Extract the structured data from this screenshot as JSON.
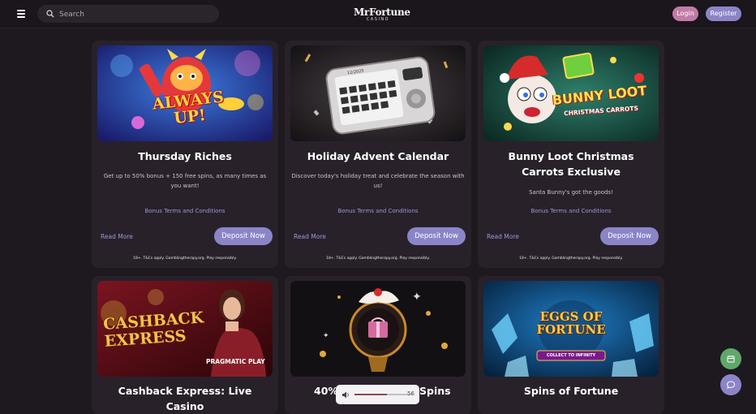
{
  "header": {
    "search_placeholder": "Search",
    "logo_main": "MrFortune",
    "logo_sub": "CASINO",
    "login_label": "Login",
    "register_label": "Register",
    "icons": [
      "menu-icon",
      "search-icon"
    ]
  },
  "promos": [
    {
      "title": "Thursday Riches",
      "desc": "Get up to 50% bonus + 150 free spins, as many times as you want!",
      "terms": "Bonus Terms and Conditions",
      "read_more": "Read More",
      "deposit": "Deposit Now",
      "disclaimer": "18+. T&Cs apply. Gamblingtherapy.org. Play responsibly.",
      "art_text": "ALWAYS UP!"
    },
    {
      "title": "Holiday Advent Calendar",
      "desc": "Discover today's holiday treat and celebrate the season with us!",
      "terms": "Bonus Terms and Conditions",
      "read_more": "Read More",
      "deposit": "Deposit Now",
      "disclaimer": "18+. T&Cs apply. Gamblingtherapy.org. Play responsibly.",
      "art_text": "12/2025"
    },
    {
      "title": "Bunny Loot Christmas Carrots Exclusive",
      "desc": "Santa Bunny's got the goods!",
      "terms": "Bonus Terms and Conditions",
      "read_more": "Read More",
      "deposit": "Deposit Now",
      "disclaimer": "18+. T&Cs apply. Gamblingtherapy.org. Play responsibly.",
      "art_text": "BUNNY LOOT",
      "art_sub": "CHRISTMAS CARROTS"
    },
    {
      "title": "Cashback Express: Live Casino",
      "art_text": "CASHBACK EXPRESS",
      "art_sub": "PRAGMATIC PLAY"
    },
    {
      "title_left": "40%",
      "title_right": "Spins"
    },
    {
      "title": "Spins of Fortune",
      "art_text": "EGGS OF FORTUNE",
      "art_sub": "COLLECT TO INFINITY"
    }
  ],
  "audio": {
    "volume": "56",
    "level": 0.56
  },
  "colors": {
    "accent": "#8b85c8",
    "login": "#c27ba8",
    "link": "#9b98d6",
    "calendar_fab": "#5fa86a",
    "chat_fab": "#8b85c8"
  }
}
